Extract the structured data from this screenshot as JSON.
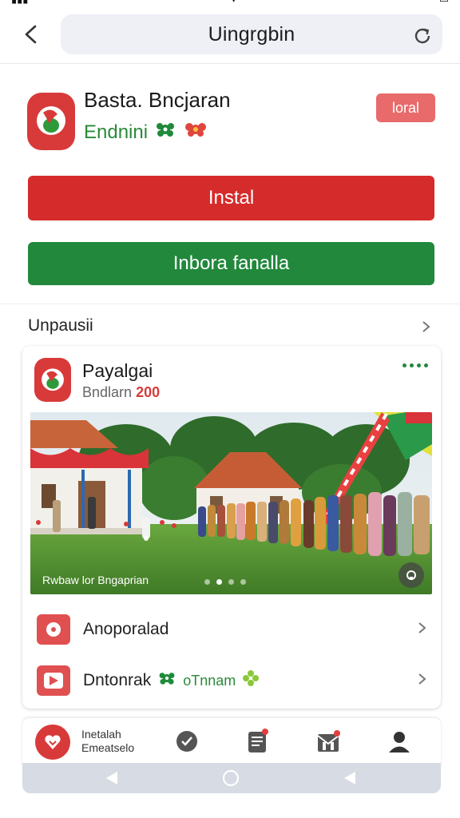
{
  "topbar": {
    "title": "Uingrgbin"
  },
  "app": {
    "name": "Basta. Bncjaran",
    "developer": "Endnini",
    "badge": "loral",
    "install_label": "Instal",
    "secondary_label": "Inbora fanalla"
  },
  "section": {
    "title": "Unpausii"
  },
  "card": {
    "title": "Payalgai",
    "subtitle": "Bndlarn",
    "subtitle_number": "200",
    "photo_caption": "Rwbaw lor  Bngaprian",
    "carousel_active": 2,
    "list": [
      {
        "label": "Anoporalad",
        "icon": "record-icon"
      },
      {
        "label": "Dntonrak",
        "extra": "oTnnam",
        "icon": "play-icon"
      }
    ]
  },
  "bottomnav": {
    "home_line1": "Inetalah",
    "home_line2": "Emeatselo"
  },
  "colors": {
    "red": "#d62b2b",
    "green": "#21883c",
    "pill": "#eef0f6"
  }
}
